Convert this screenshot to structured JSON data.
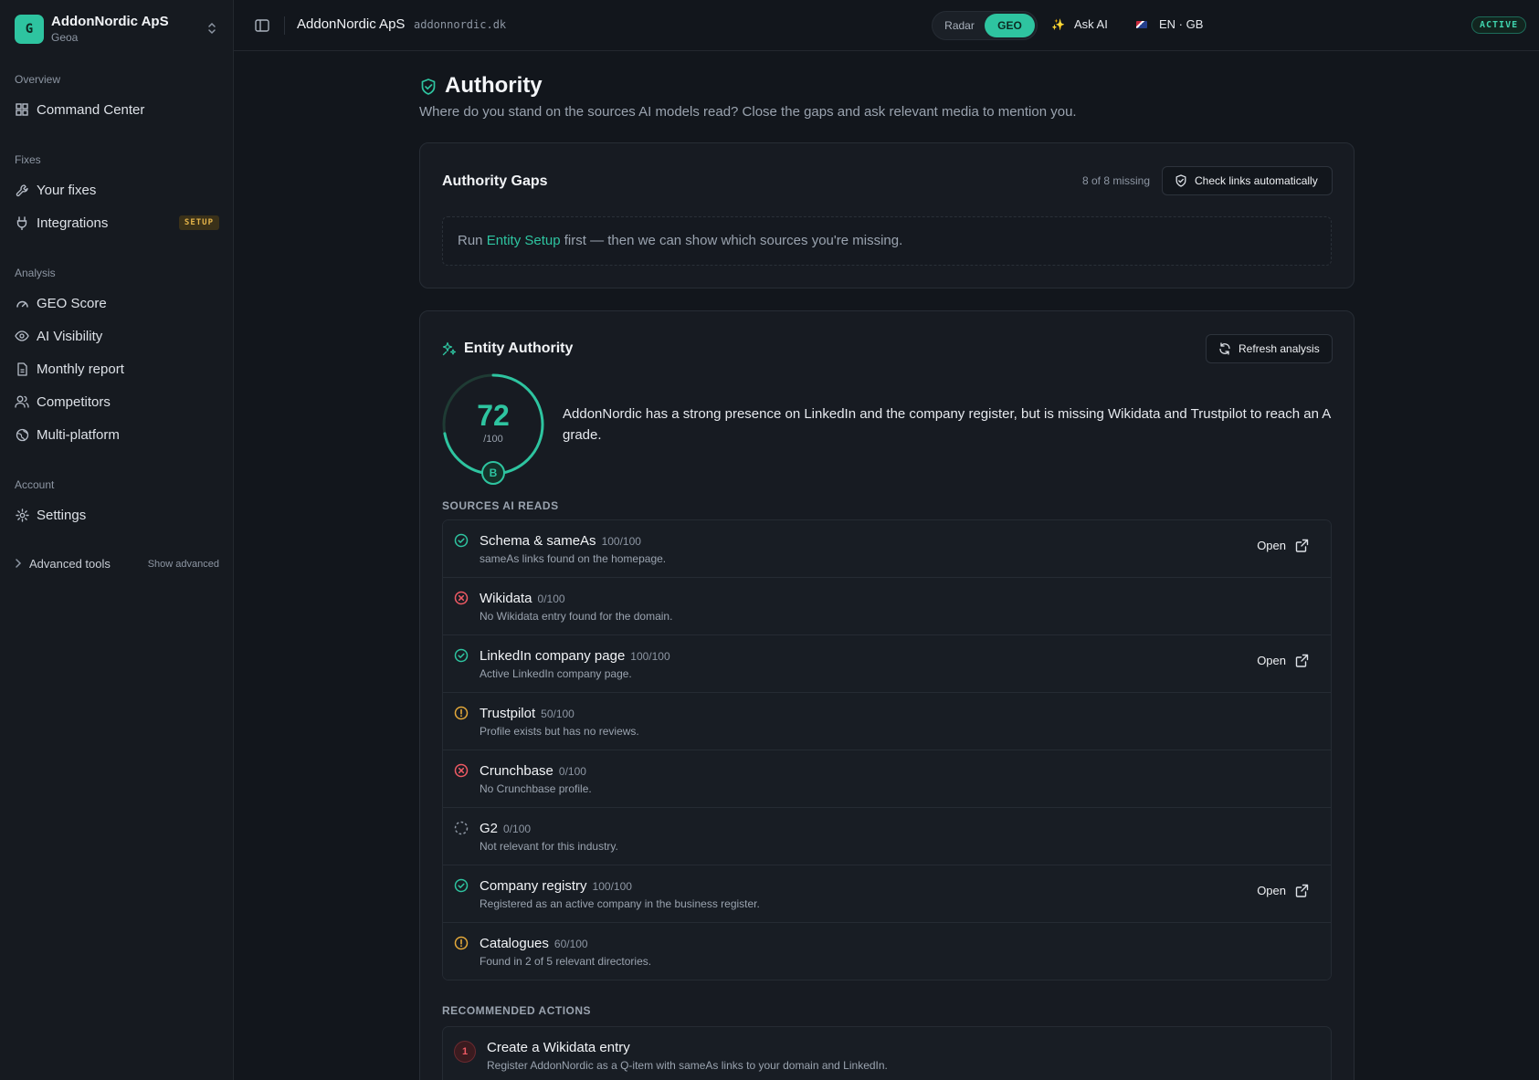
{
  "org": {
    "initial": "G",
    "name": "AddonNordic ApS",
    "sub": "Geoa"
  },
  "sidebar": {
    "sections": [
      {
        "label": "Overview",
        "items": [
          {
            "label": "Command Center",
            "icon": "grid-icon"
          }
        ]
      },
      {
        "label": "Fixes",
        "items": [
          {
            "label": "Your fixes",
            "icon": "wrench-icon"
          },
          {
            "label": "Integrations",
            "icon": "plug-icon",
            "badge": "SETUP"
          }
        ]
      },
      {
        "label": "Analysis",
        "items": [
          {
            "label": "GEO Score",
            "icon": "gauge-icon"
          },
          {
            "label": "AI Visibility",
            "icon": "eye-icon"
          },
          {
            "label": "Monthly report",
            "icon": "file-icon"
          },
          {
            "label": "Competitors",
            "icon": "users-icon"
          },
          {
            "label": "Multi-platform",
            "icon": "globe-icon"
          }
        ]
      },
      {
        "label": "Account",
        "items": [
          {
            "label": "Settings",
            "icon": "gear-icon"
          }
        ]
      }
    ],
    "advanced": {
      "label": "Advanced tools",
      "toggle": "Show advanced"
    }
  },
  "topbar": {
    "title": "AddonNordic ApS",
    "domain": "addonnordic.dk",
    "segment": {
      "options": [
        "Radar",
        "GEO"
      ],
      "selected": "GEO"
    },
    "ask_ai": "Ask AI",
    "language": "EN · GB",
    "status": "ACTIVE"
  },
  "page": {
    "title": "Authority",
    "subtitle": "Where do you stand on the sources AI models read? Close the gaps and ask relevant media to mention you."
  },
  "gaps": {
    "title": "Authority Gaps",
    "count": "8 of 8 missing",
    "button": "Check links automatically",
    "empty_prefix": "Run ",
    "empty_link": "Entity Setup",
    "empty_suffix": " first — then we can show which sources you're missing."
  },
  "entity": {
    "title": "Entity Authority",
    "refresh": "Refresh analysis",
    "score": 72,
    "score_max": "/100",
    "score_fraction": 0.72,
    "grade": "B",
    "summary": "AddonNordic has a strong presence on LinkedIn and the company register, but is missing Wikidata and Trustpilot to reach an A grade.",
    "sources_label": "SOURCES AI READS",
    "open_label": "Open",
    "sources": [
      {
        "name": "Schema & sameAs",
        "score": "100/100",
        "desc": "sameAs links found on the homepage.",
        "status": "ok",
        "open": true
      },
      {
        "name": "Wikidata",
        "score": "0/100",
        "desc": "No Wikidata entry found for the domain.",
        "status": "missing",
        "open": false
      },
      {
        "name": "LinkedIn company page",
        "score": "100/100",
        "desc": "Active LinkedIn company page.",
        "status": "ok",
        "open": true
      },
      {
        "name": "Trustpilot",
        "score": "50/100",
        "desc": "Profile exists but has no reviews.",
        "status": "warn",
        "open": false
      },
      {
        "name": "Crunchbase",
        "score": "0/100",
        "desc": "No Crunchbase profile.",
        "status": "missing",
        "open": false
      },
      {
        "name": "G2",
        "score": "0/100",
        "desc": "Not relevant for this industry.",
        "status": "na",
        "open": false
      },
      {
        "name": "Company registry",
        "score": "100/100",
        "desc": "Registered as an active company in the business register.",
        "status": "ok",
        "open": true
      },
      {
        "name": "Catalogues",
        "score": "60/100",
        "desc": "Found in 2 of 5 relevant directories.",
        "status": "warn",
        "open": false
      }
    ],
    "actions_label": "RECOMMENDED ACTIONS",
    "actions": [
      {
        "num": "1",
        "title": "Create a Wikidata entry",
        "desc": "Register AddonNordic as a Q-item with sameAs links to your domain and LinkedIn."
      }
    ]
  },
  "colors": {
    "accent": "#2ec4a0",
    "ok": "#2ec4a0",
    "missing": "#ef5a64",
    "warn": "#e4a93a",
    "na": "#8d96a3"
  }
}
